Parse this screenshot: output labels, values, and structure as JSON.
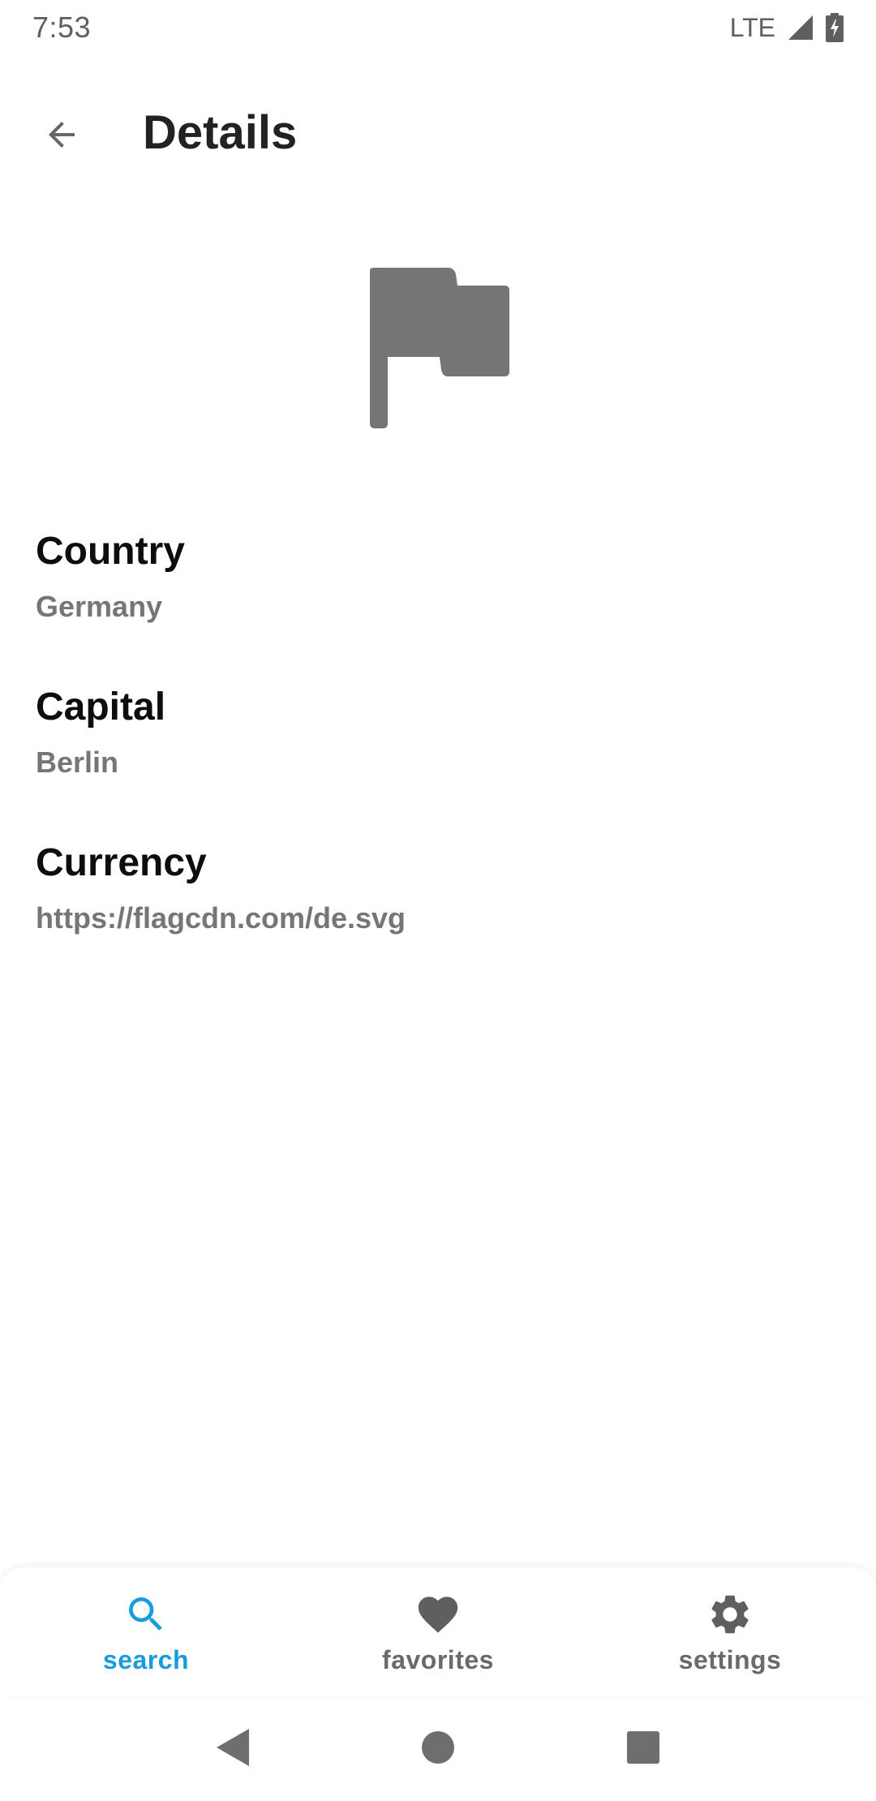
{
  "status_bar": {
    "time": "7:53",
    "network": "LTE",
    "icons": [
      "signal-icon",
      "battery-charging-icon"
    ]
  },
  "app_bar": {
    "back_icon": "arrow-back-icon",
    "title": "Details"
  },
  "flag": {
    "icon": "flag-icon",
    "color": "#757575"
  },
  "details": [
    {
      "label": "Country",
      "value": "Germany"
    },
    {
      "label": "Capital",
      "value": "Berlin"
    },
    {
      "label": "Currency",
      "value": "https://flagcdn.com/de.svg"
    }
  ],
  "bottom_nav": {
    "accent_color": "#1a9be0",
    "inactive_color": "#6a6a6a",
    "items": [
      {
        "label": "search",
        "icon": "search-icon",
        "active": true
      },
      {
        "label": "favorites",
        "icon": "heart-icon",
        "active": false
      },
      {
        "label": "settings",
        "icon": "gear-icon",
        "active": false
      }
    ]
  },
  "system_nav": {
    "buttons": [
      "back-triangle-icon",
      "home-circle-icon",
      "recents-square-icon"
    ]
  }
}
